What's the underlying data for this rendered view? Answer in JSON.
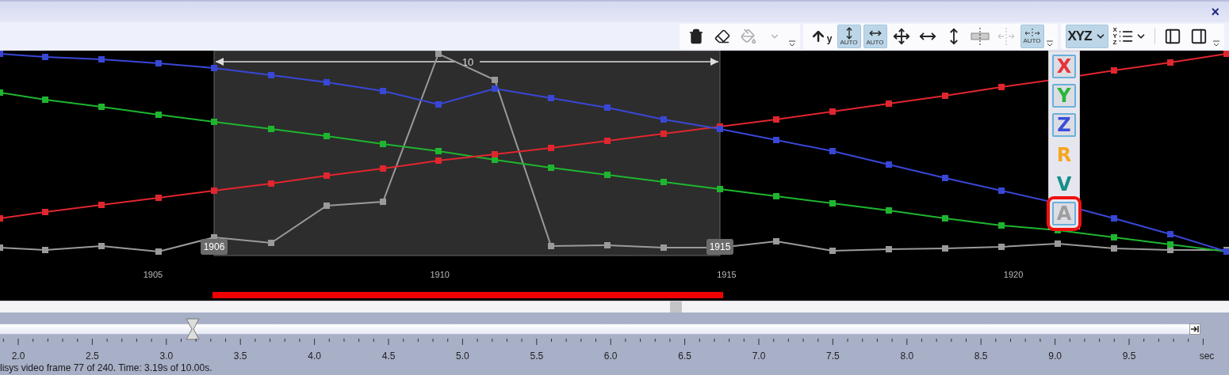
{
  "window": {
    "close": "×"
  },
  "toolbar": {
    "groups": [
      {
        "buttons": [
          {
            "kind": "trash",
            "selected": false,
            "disabled": false
          },
          {
            "kind": "eraser",
            "selected": false,
            "disabled": false
          },
          {
            "kind": "bucket",
            "selected": false,
            "disabled": true
          },
          {
            "kind": "chevron",
            "selected": false,
            "disabled": true
          }
        ]
      },
      {
        "buttons": [
          {
            "kind": "axis_up",
            "label": "y",
            "selected": false,
            "disabled": false
          },
          {
            "kind": "auto_vertical",
            "label": "AUTO",
            "selected": true,
            "disabled": false
          },
          {
            "kind": "auto_horizontal",
            "label": "AUTO",
            "selected": true,
            "disabled": false
          },
          {
            "kind": "move",
            "selected": false,
            "disabled": false
          },
          {
            "kind": "fit_horizontal",
            "selected": false,
            "disabled": false
          },
          {
            "kind": "fit_vertical",
            "selected": false,
            "disabled": false
          },
          {
            "kind": "split",
            "selected": false,
            "disabled": false
          },
          {
            "kind": "spread",
            "selected": false,
            "disabled": true
          },
          {
            "kind": "auto_spread",
            "label": "AUTO",
            "selected": true,
            "disabled": false
          }
        ]
      },
      {
        "buttons": [
          {
            "kind": "xyz_dropdown",
            "label": "XYZ",
            "selected": true,
            "disabled": false
          },
          {
            "kind": "xyz_list",
            "label": "XYZ",
            "selected": false,
            "disabled": false
          },
          {
            "kind": "panel_left",
            "selected": false,
            "disabled": false
          },
          {
            "kind": "panel_right",
            "selected": false,
            "disabled": false
          }
        ]
      }
    ]
  },
  "axis_menu": [
    {
      "label": "X",
      "color": "#e8323a",
      "checked": true,
      "highlighted": false
    },
    {
      "label": "Y",
      "color": "#2bb53a",
      "checked": true,
      "highlighted": false
    },
    {
      "label": "Z",
      "color": "#3a4fd8",
      "checked": true,
      "highlighted": false
    },
    {
      "label": "R",
      "color": "#f5a623",
      "checked": false,
      "highlighted": false
    },
    {
      "label": "V",
      "color": "#178f8a",
      "checked": false,
      "highlighted": false
    },
    {
      "label": "A",
      "color": "#9e9e9e",
      "checked": true,
      "highlighted": true
    }
  ],
  "chart": {
    "x_tick_labels": [
      "1905",
      "1910",
      "1915",
      "1920"
    ],
    "selection": {
      "start_label": "1906",
      "end_label": "1915",
      "span_label": "10"
    }
  },
  "timeline": {
    "tick_labels": [
      "2.0",
      "2.5",
      "3.0",
      "3.5",
      "4.0",
      "4.5",
      "5.0",
      "5.5",
      "6.0",
      "6.5",
      "7.0",
      "7.5",
      "8.0",
      "8.5",
      "9.0",
      "9.5"
    ],
    "unit": "sec",
    "level": 0.162
  },
  "status_bar": "lisys video frame 77 of 240. Time: 3.19s of 10.00s."
}
